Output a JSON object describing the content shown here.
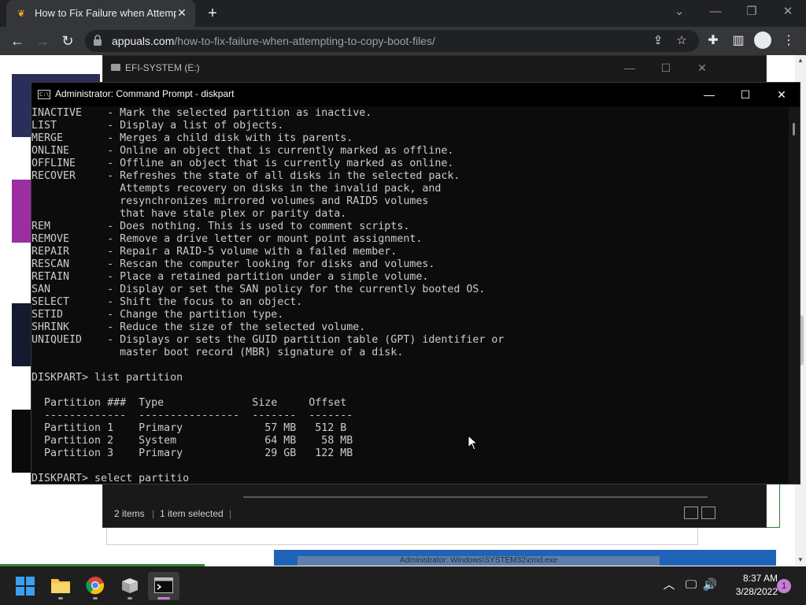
{
  "browser": {
    "tab_title": "How to Fix Failure when Attempting to Copy Boot Files",
    "tab_close": "✕",
    "new_tab": "+",
    "url_host": "appuals.com",
    "url_path": "/how-to-fix-failure-when-attempting-to-copy-boot-files/",
    "icons": [
      "tab-search-icon",
      "minimize-icon",
      "restore-icon",
      "close-icon",
      "back-icon",
      "forward-icon",
      "reload-icon",
      "lock-icon",
      "share-icon",
      "bookmark-star-icon",
      "extensions-icon",
      "side-panel-icon",
      "profile-icon",
      "menu-icon"
    ]
  },
  "explorer": {
    "title": "EFI-SYSTEM (E:)",
    "items_count": "2 items",
    "selection": "1 item selected"
  },
  "cmd": {
    "title": "Administrator: Command Prompt - diskpart",
    "lines": [
      "INACTIVE    - Mark the selected partition as inactive.",
      "LIST        - Display a list of objects.",
      "MERGE       - Merges a child disk with its parents.",
      "ONLINE      - Online an object that is currently marked as offline.",
      "OFFLINE     - Offline an object that is currently marked as online.",
      "RECOVER     - Refreshes the state of all disks in the selected pack.",
      "              Attempts recovery on disks in the invalid pack, and",
      "              resynchronizes mirrored volumes and RAID5 volumes",
      "              that have stale plex or parity data.",
      "REM         - Does nothing. This is used to comment scripts.",
      "REMOVE      - Remove a drive letter or mount point assignment.",
      "REPAIR      - Repair a RAID-5 volume with a failed member.",
      "RESCAN      - Rescan the computer looking for disks and volumes.",
      "RETAIN      - Place a retained partition under a simple volume.",
      "SAN         - Display or set the SAN policy for the currently booted OS.",
      "SELECT      - Shift the focus to an object.",
      "SETID       - Change the partition type.",
      "SHRINK      - Reduce the size of the selected volume.",
      "UNIQUEID    - Displays or sets the GUID partition table (GPT) identifier or",
      "              master boot record (MBR) signature of a disk.",
      "",
      "DISKPART> list partition",
      "",
      "  Partition ###  Type              Size     Offset",
      "  -------------  ----------------  -------  -------",
      "  Partition 1    Primary             57 MB   512 B",
      "  Partition 2    System              64 MB    58 MB",
      "  Partition 3    Primary             29 GB   122 MB",
      "",
      "DISKPART> select partitio"
    ]
  },
  "banner_text": "Administrator: Windows\\SYSTEM32\\cmd.exe",
  "taskbar": {
    "apps": [
      "start-icon",
      "file-explorer-icon",
      "chrome-icon",
      "app-box-icon",
      "terminal-icon"
    ],
    "time": "8:37 AM",
    "date": "3/28/2022",
    "notifications": "1"
  },
  "colors": {
    "console_bg": "#0c0c0c",
    "console_text": "#cccccc",
    "chrome_dark": "#202124",
    "taskbar_bg": "#1f1f1f",
    "accent": "#c77dd6"
  }
}
